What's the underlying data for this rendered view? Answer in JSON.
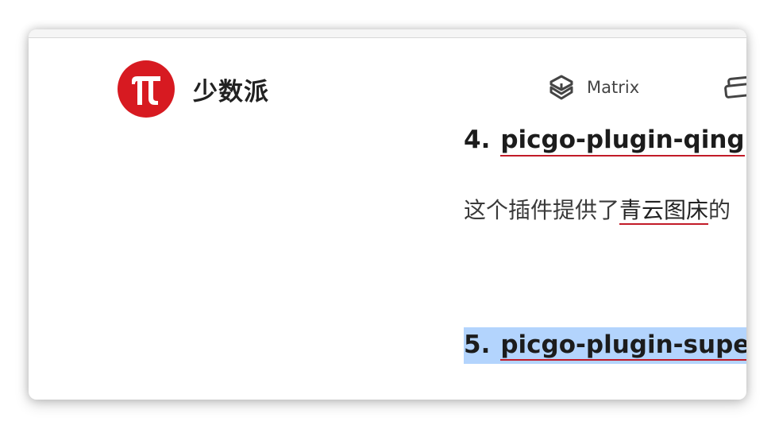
{
  "brand": {
    "name": "少数派",
    "logo_glyph": "π",
    "logo_color": "#d71a21"
  },
  "nav": {
    "matrix_label": "Matrix",
    "matrix_icon": "cube-icon",
    "next_icon": "layers-icon"
  },
  "article": {
    "heading_4": {
      "number": "4.",
      "link_text": "picgo-plugin-qing"
    },
    "paragraph": {
      "text_before": "这个插件提供了",
      "link_text": "青云图床",
      "text_after": "的"
    },
    "heading_5": {
      "number": "5.",
      "link_text": "picgo-plugin-supe"
    }
  },
  "colors": {
    "link_underline": "#c21b28",
    "selection": "#b3d4fd"
  }
}
